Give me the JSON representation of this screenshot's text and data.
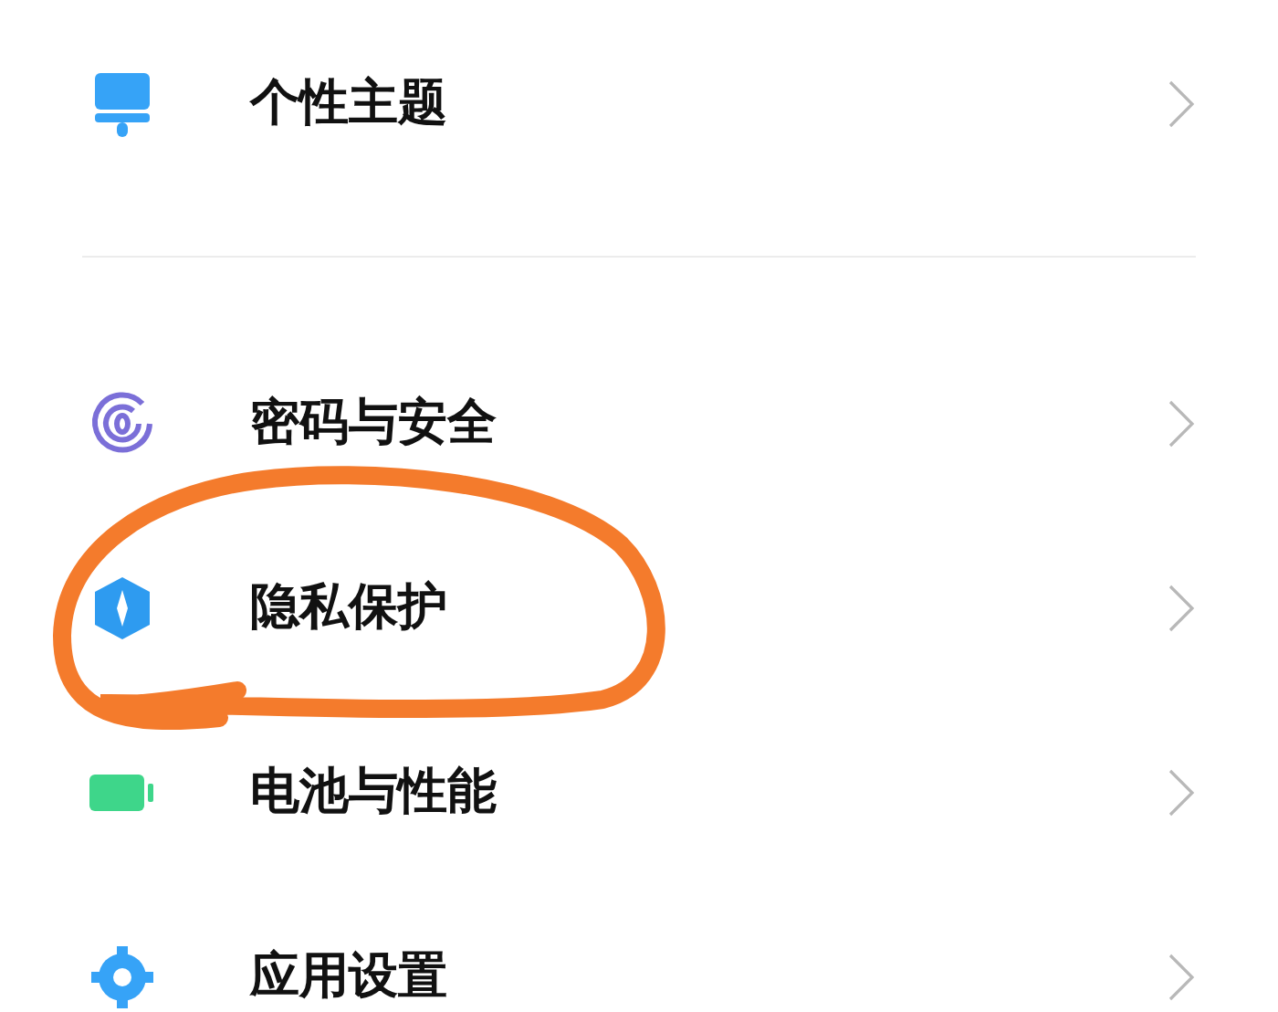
{
  "sections": [
    {
      "items": [
        {
          "label": "个性主题"
        }
      ]
    },
    {
      "items": [
        {
          "label": "密码与安全"
        },
        {
          "label": "隐私保护"
        },
        {
          "label": "电池与性能"
        },
        {
          "label": "应用设置"
        }
      ]
    }
  ],
  "annotation": {
    "kind": "circle",
    "color": "#f47b2c"
  }
}
